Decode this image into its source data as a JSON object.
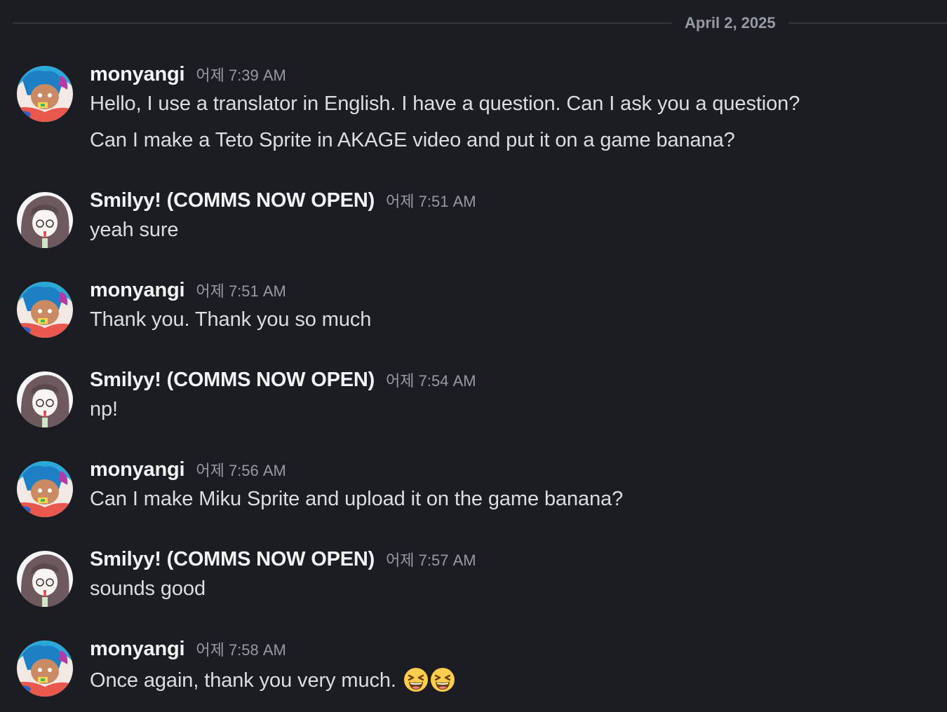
{
  "date_divider": "April 2, 2025",
  "messages": [
    {
      "author": "monyangi",
      "time": "어제 7:39 AM",
      "lines": [
        "Hello, I use a translator in English. I have a question. Can I ask you a question?",
        "Can I make a Teto Sprite in AKAGE video and put it on a game banana?"
      ]
    },
    {
      "author": "Smilyy! (COMMS NOW OPEN)",
      "time": "어제 7:51 AM",
      "lines": [
        "yeah sure"
      ]
    },
    {
      "author": "monyangi",
      "time": "어제 7:51 AM",
      "lines": [
        "Thank you. Thank you so much"
      ]
    },
    {
      "author": "Smilyy! (COMMS NOW OPEN)",
      "time": "어제 7:54 AM",
      "lines": [
        "np!"
      ]
    },
    {
      "author": "monyangi",
      "time": "어제 7:56 AM",
      "lines": [
        "Can I make Miku Sprite and upload it on the game banana?"
      ]
    },
    {
      "author": "Smilyy! (COMMS NOW OPEN)",
      "time": "어제 7:57 AM",
      "lines": [
        "sounds good"
      ]
    },
    {
      "author": "monyangi",
      "time": "어제 7:58 AM",
      "lines": [
        "Once again, thank you very much."
      ],
      "emojis": [
        "laughing-emoji",
        "laughing-emoji"
      ]
    }
  ],
  "colors": {
    "background": "#1c1d22",
    "username": "#f2f3f5",
    "timestamp": "#949ba4",
    "message_text": "#dbdee1",
    "divider_line": "#33353b"
  }
}
